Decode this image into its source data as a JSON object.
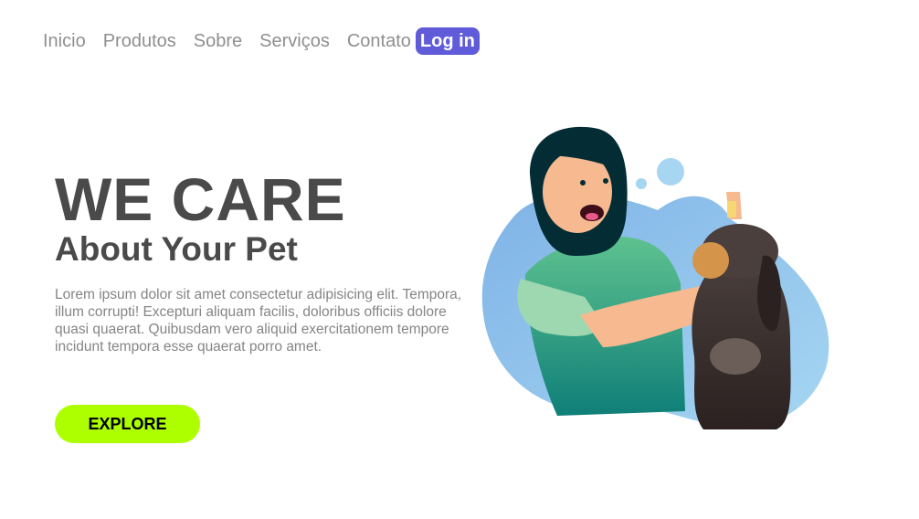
{
  "nav": {
    "items": [
      "Inicio",
      "Produtos",
      "Sobre",
      "Serviços",
      "Contato"
    ],
    "login_label": "Log in"
  },
  "hero": {
    "title": "WE CARE",
    "subtitle": "About Your Pet",
    "text": "Lorem ipsum dolor sit amet consectetur adipisicing elit. Tempora, illum corrupti! Excepturi aliquam facilis, doloribus officiis dolore quasi quaerat. Quibusdam vero aliquid exercitationem tempore incidunt tempora esse quaerat porro amet.",
    "button_label": "EXPLORE"
  },
  "colors": {
    "accent": "#5f5bd9",
    "button": "#adff00",
    "heading": "#4a4a4a"
  }
}
